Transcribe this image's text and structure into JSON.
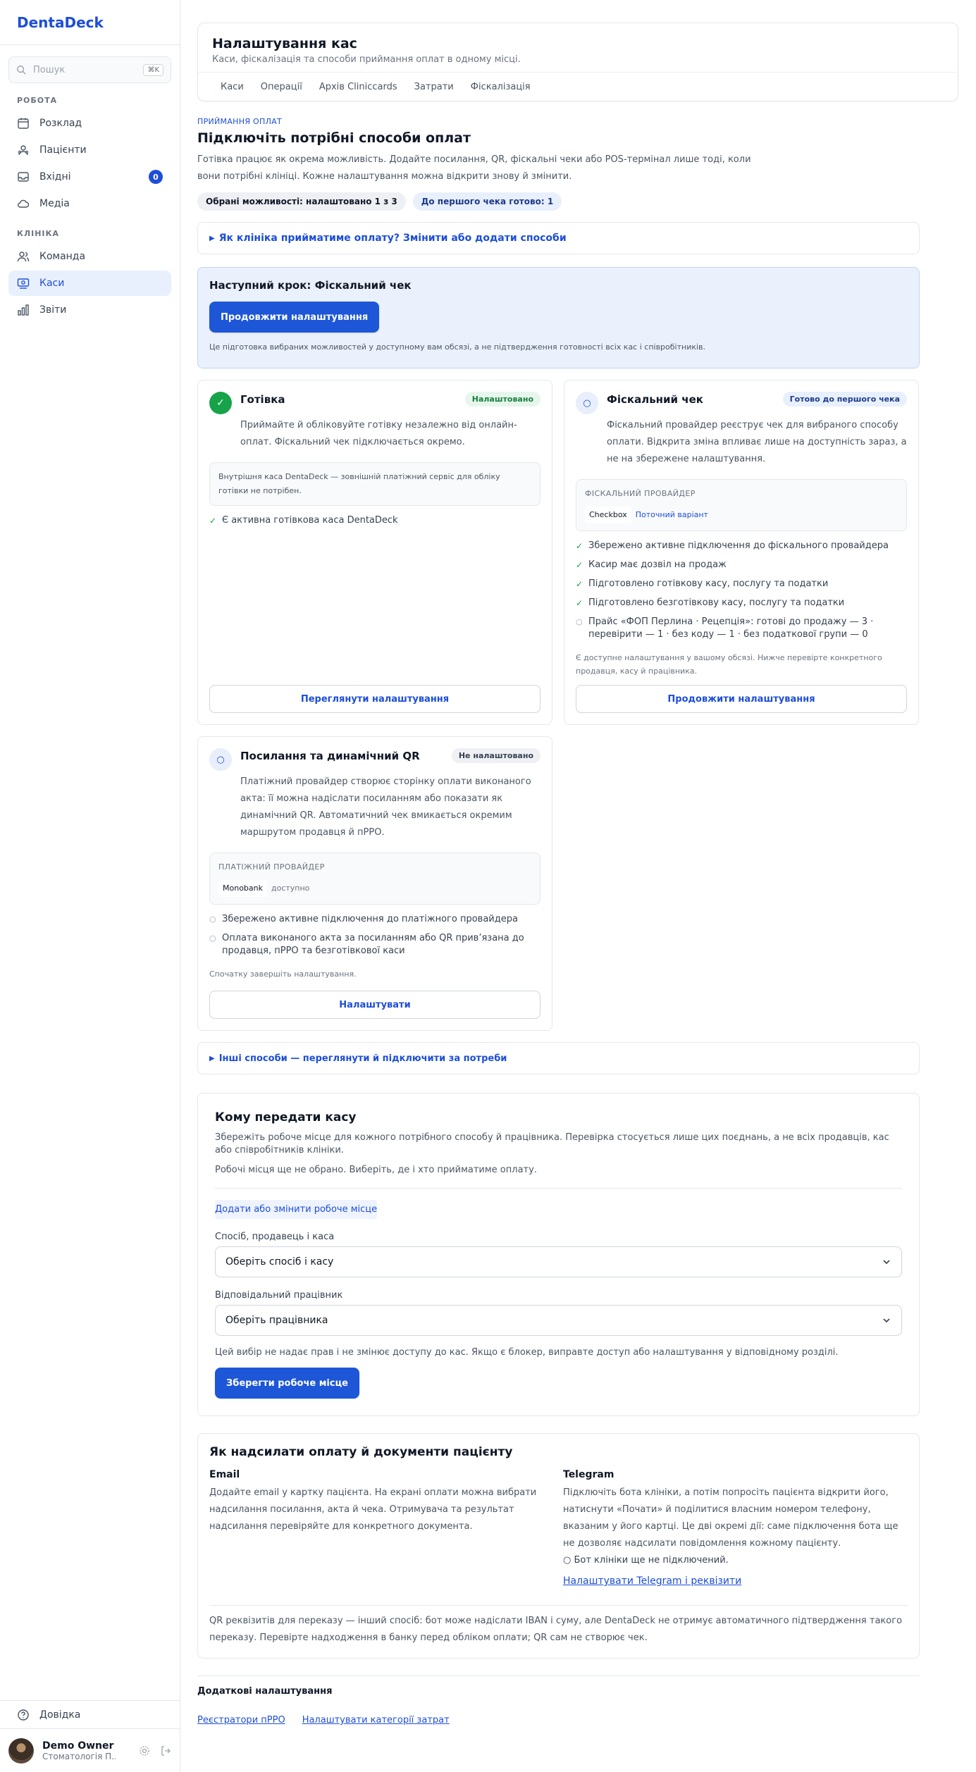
{
  "sidebar": {
    "brand": "DentaDeck",
    "search_placeholder": "Пошук",
    "search_shortcut": "⌘K",
    "section_work": "РОБОТА",
    "section_clinic": "КЛІНІКА",
    "items_work": [
      {
        "label": "Розклад",
        "icon": "calendar-icon"
      },
      {
        "label": "Пацієнти",
        "icon": "patients-icon"
      },
      {
        "label": "Вхідні",
        "icon": "inbox-icon",
        "badge": "0"
      },
      {
        "label": "Медіа",
        "icon": "cloud-icon"
      }
    ],
    "items_clinic": [
      {
        "label": "Команда",
        "icon": "team-icon"
      },
      {
        "label": "Каси",
        "icon": "cashbox-icon",
        "active": true
      },
      {
        "label": "Звіти",
        "icon": "reports-icon"
      }
    ],
    "help_label": "Довідка",
    "user_name": "Demo Owner",
    "user_org": "Стоматологія П..."
  },
  "header": {
    "title": "Налаштування кас",
    "subtitle": "Каси, фіскалізація та способи приймання оплат в одному місці.",
    "tabs": [
      "Каси",
      "Операції",
      "Архів Cliniccards",
      "Затрати",
      "Фіскалізація"
    ]
  },
  "intro": {
    "eyebrow": "ПРИЙМАННЯ ОПЛАТ",
    "title": "Підключіть потрібні способи оплат",
    "text": "Готівка працює як окрема можливість. Додайте посилання, QR, фіскальні чеки або POS-термінал лише тоді, коли вони потрібні клініці. Кожне налаштування можна відкрити знову й змінити.",
    "pill_selected": "Обрані можливості: налаштовано 1 з 3",
    "pill_ready": "До першого чека готово: 1",
    "change_methods": "Як клініка прийматиме оплату? Змінити або додати способи"
  },
  "next_step": {
    "title": "Наступний крок: Фіскальний чек",
    "button": "Продовжити налаштування",
    "note": "Це підготовка вибраних можливостей у доступному вам обсязі, а не підтвердження готовності всіх кас і співробітників."
  },
  "cards": {
    "cash": {
      "title": "Готівка",
      "badge": "Налаштовано",
      "desc": "Приймайте й обліковуйте готівку незалежно від онлайн-оплат. Фіскальний чек підключається окремо.",
      "info": "Внутрішня каса DentaDeck — зовнішній платіжний сервіс для обліку готівки не потрібен.",
      "checks": [
        "Є активна готівкова каса DentaDeck"
      ],
      "button": "Переглянути налаштування"
    },
    "fiscal": {
      "title": "Фіскальний чек",
      "badge": "Готово до першого чека",
      "desc": "Фіскальний провайдер реєструє чек для вибраного способу оплати. Відкрита зміна впливає лише на доступність зараз, а не на збережене налаштування.",
      "provider_label": "ФІСКАЛЬНИЙ ПРОВАЙДЕР",
      "provider_name": "Checkbox",
      "provider_note": "Поточний варіант",
      "checks": [
        "Збережено активне підключення до фіскального провайдера",
        "Касир має дозвіл на продаж",
        "Підготовлено готівкову касу, послугу та податки",
        "Підготовлено безготівкову касу, послугу та податки"
      ],
      "pending_check": "Прайс «ФОП Перлина · Рецепція»: готові до продажу — 3 · перевірити — 1 · без коду — 1 · без податкової групи — 0",
      "hint": "Є доступне налаштування у вашому обсязі. Нижче перевірте конкретного продавця, касу й працівника.",
      "button": "Продовжити налаштування"
    },
    "qr": {
      "title": "Посилання та динамічний QR",
      "badge": "Не налаштовано",
      "desc": "Платіжний провайдер створює сторінку оплати виконаного акта: її можна надіслати посиланням або показати як динамічний QR. Автоматичний чек вмикається окремим маршрутом продавця й пРРО.",
      "provider_label": "ПЛАТІЖНИЙ ПРОВАЙДЕР",
      "provider_name": "Monobank",
      "provider_note": "доступно",
      "checks": [
        "Збережено активне підключення до платіжного провайдера",
        "Оплата виконаного акта за посиланням або QR прив’язана до продавця, пРРО та безготівкової каси"
      ],
      "hint": "Спочатку завершіть налаштування.",
      "button": "Налаштувати"
    }
  },
  "other_methods": "Інші способи — переглянути й підключити за потреби",
  "assign": {
    "title": "Кому передати касу",
    "text1": "Збережіть робоче місце для кожного потрібного способу й працівника. Перевірка стосується лише цих поєднань, а не всіх продавців, кас або співробітників клініки.",
    "text2": "Робочі місця ще не обрано. Виберіть, де і хто прийматиме оплату.",
    "add_link": "Додати або змінити робоче місце",
    "field1_label": "Спосіб, продавець і каса",
    "field1_value": "Оберіть спосіб і касу",
    "field2_label": "Відповідальний працівник",
    "field2_value": "Оберіть працівника",
    "note": "Цей вибір не надає прав і не змінює доступу до кас. Якщо є блокер, виправте доступ або налаштування у відповідному розділі.",
    "save_button": "Зберегти робоче місце"
  },
  "send": {
    "title": "Як надсилати оплату й документи пацієнту",
    "email_title": "Email",
    "email_text": "Додайте email у картку пацієнта. На екрані оплати можна вибрати надсилання посилання, акта й чека. Отримувача та результат надсилання перевіряйте для конкретного документа.",
    "tg_title": "Telegram",
    "tg_text": "Підключіть бота клініки, а потім попросіть пацієнта відкрити його, натиснути «Почати» й поділитися власним номером телефону, вказаним у його картці. Це дві окремі дії: саме підключення бота ще не дозволяє надсилати повідомлення кожному пацієнту.",
    "tg_status": "○ Бот клініки ще не підключений.",
    "tg_link": "Налаштувати Telegram і реквізити",
    "footer": "QR реквізитів для переказу — інший спосіб: бот може надіслати IBAN і суму, але DentaDeck не отримує автоматичного підтвердження такого переказу. Перевірте надходження в банку перед обліком оплати; QR сам не створює чек."
  },
  "extra": {
    "title": "Додаткові налаштування",
    "links": [
      "Реєстратори пРРО",
      "Налаштувати категорії затрат"
    ]
  },
  "colors": {
    "accent": "#1d57d8",
    "success": "#16a34a",
    "panel": "#eaf1fd"
  }
}
